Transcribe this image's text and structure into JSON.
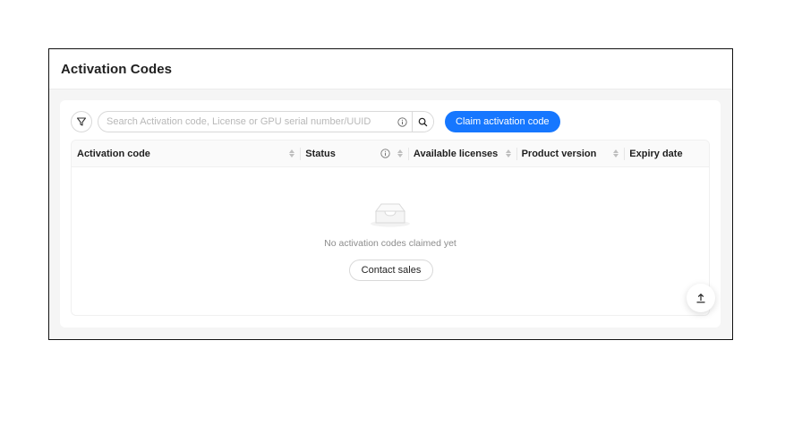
{
  "page": {
    "title": "Activation Codes"
  },
  "toolbar": {
    "filter_icon": "filter-icon",
    "search_placeholder": "Search Activation code, License or GPU serial number/UUID",
    "search_info_icon": "info-icon",
    "search_icon": "search-icon",
    "claim_button_label": "Claim activation code"
  },
  "table": {
    "columns": [
      {
        "label": "Activation code",
        "sortable": true,
        "info": false
      },
      {
        "label": "Status",
        "sortable": true,
        "info": true
      },
      {
        "label": "Available licenses",
        "sortable": true,
        "info": false
      },
      {
        "label": "Product version",
        "sortable": true,
        "info": false
      },
      {
        "label": "Expiry date",
        "sortable": false,
        "info": false
      }
    ],
    "empty": {
      "icon": "empty-inbox-icon",
      "message": "No activation codes claimed yet",
      "action_label": "Contact sales"
    }
  },
  "back_to_top_icon": "arrow-up-icon",
  "colors": {
    "accent": "#1677ff",
    "border": "#d9d9d9",
    "muted_text": "#8c8c8c",
    "header_bg": "#fafafa"
  }
}
